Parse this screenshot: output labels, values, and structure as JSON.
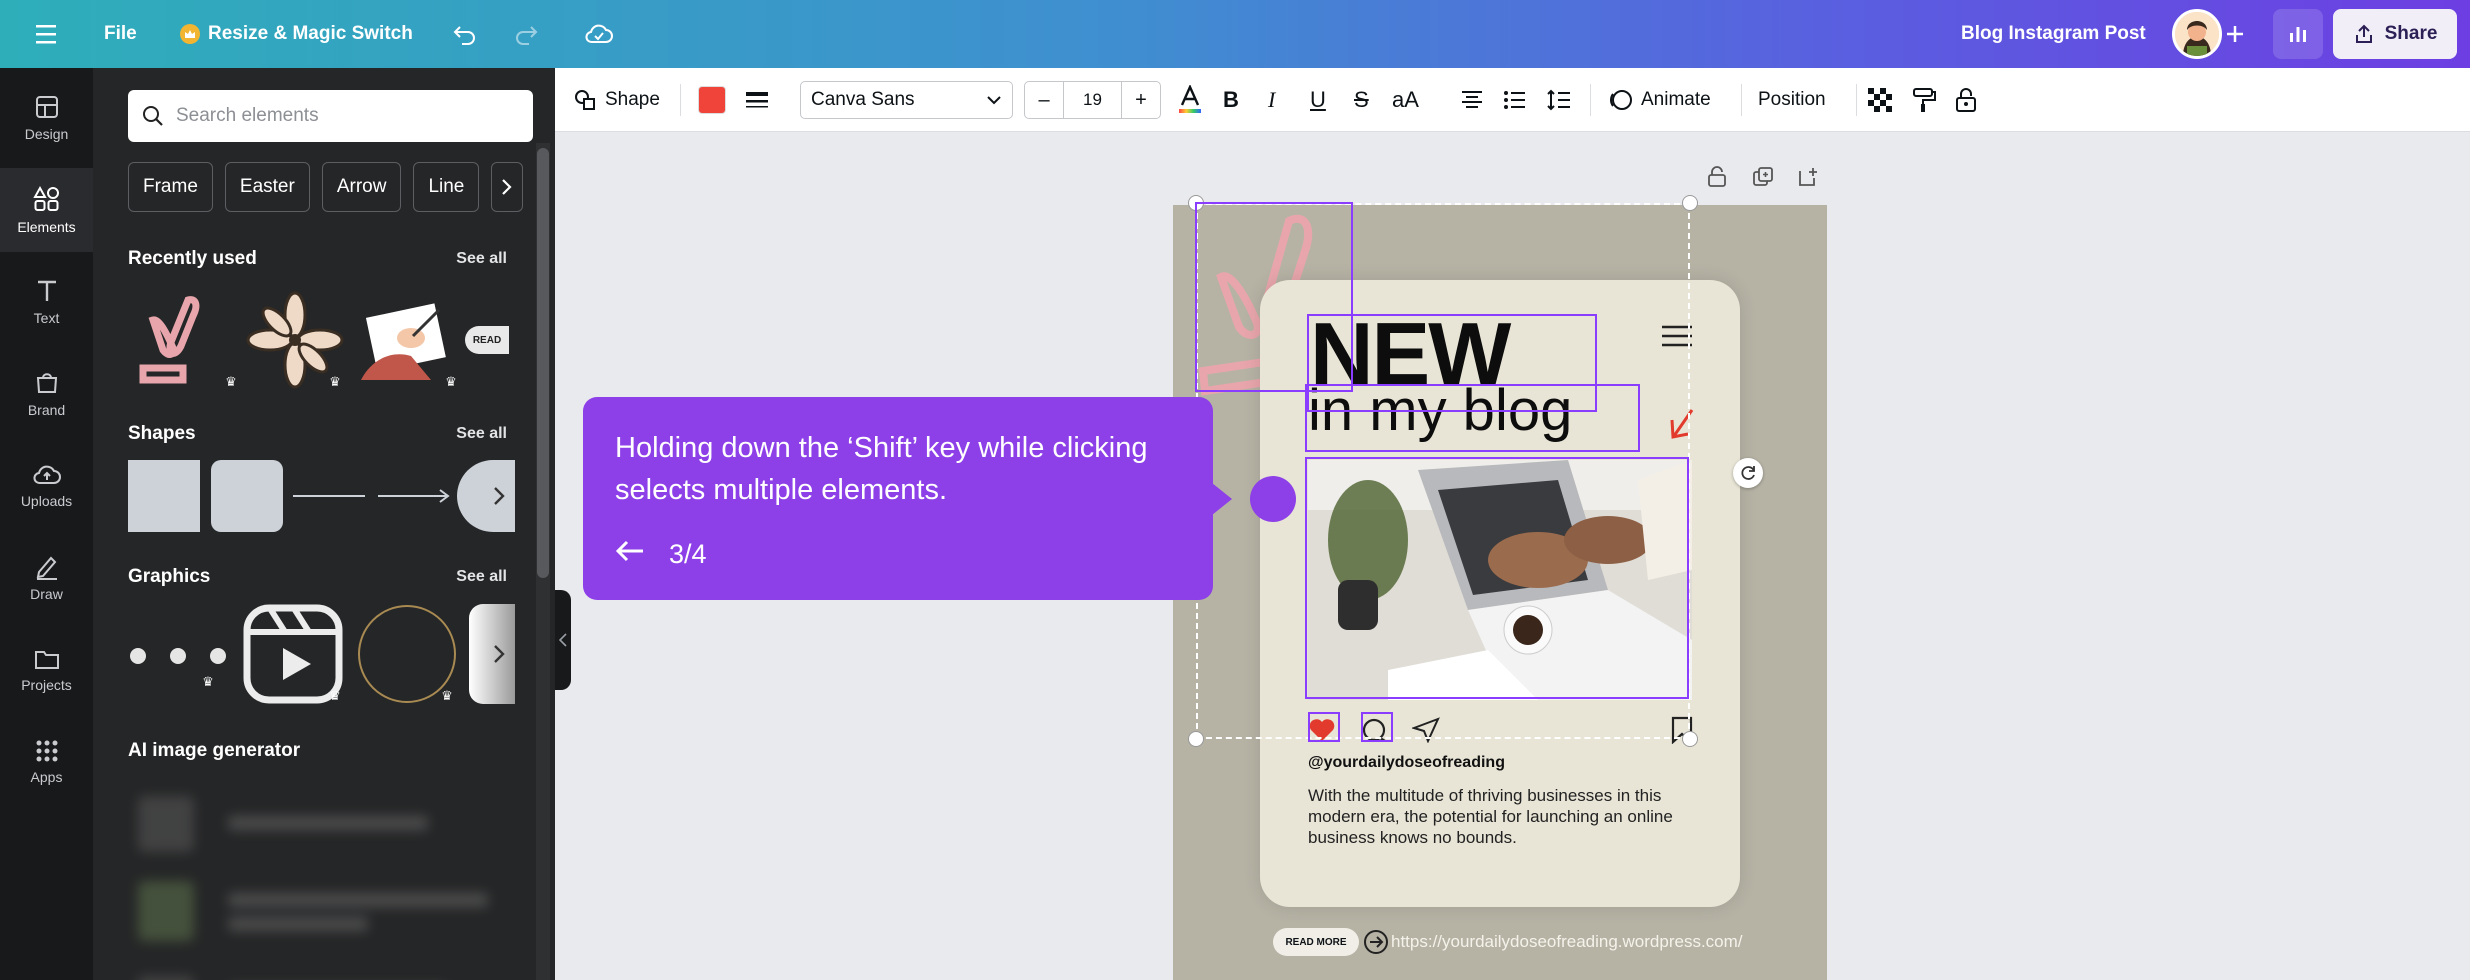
{
  "topbar": {
    "file_label": "File",
    "resize_label": "Resize & Magic Switch",
    "doc_title": "Blog Instagram Post",
    "share_label": "Share"
  },
  "rail": {
    "items": [
      {
        "label": "Design"
      },
      {
        "label": "Elements"
      },
      {
        "label": "Text"
      },
      {
        "label": "Brand"
      },
      {
        "label": "Uploads"
      },
      {
        "label": "Draw"
      },
      {
        "label": "Projects"
      },
      {
        "label": "Apps"
      }
    ]
  },
  "panel": {
    "search_placeholder": "Search elements",
    "chips": [
      "Frame",
      "Easter",
      "Arrow",
      "Line"
    ],
    "sections": {
      "recently_used": "Recently used",
      "shapes": "Shapes",
      "graphics": "Graphics",
      "ai_generator": "AI image generator"
    },
    "see_all": "See all",
    "recent_badge": "READ"
  },
  "toolbar": {
    "shape_label": "Shape",
    "shape_color": "#f0443a",
    "font_name": "Canva Sans",
    "font_size": "19",
    "minus": "–",
    "plus": "+",
    "case_label": "aA",
    "animate_label": "Animate",
    "position_label": "Position"
  },
  "design": {
    "title_new": "NEW",
    "title_sub": "in my blog",
    "handle": "@yourdailydoseofreading",
    "description": "With the multitude of thriving businesses in this modern era, the potential for launching an online business knows no bounds.",
    "read_more": "READ MORE",
    "url": "https://yourdailydoseofreading.wordpress.com/"
  },
  "tooltip": {
    "text": "Holding down the ‘Shift’ key while clicking selects multiple elements.",
    "step": "3/4"
  }
}
